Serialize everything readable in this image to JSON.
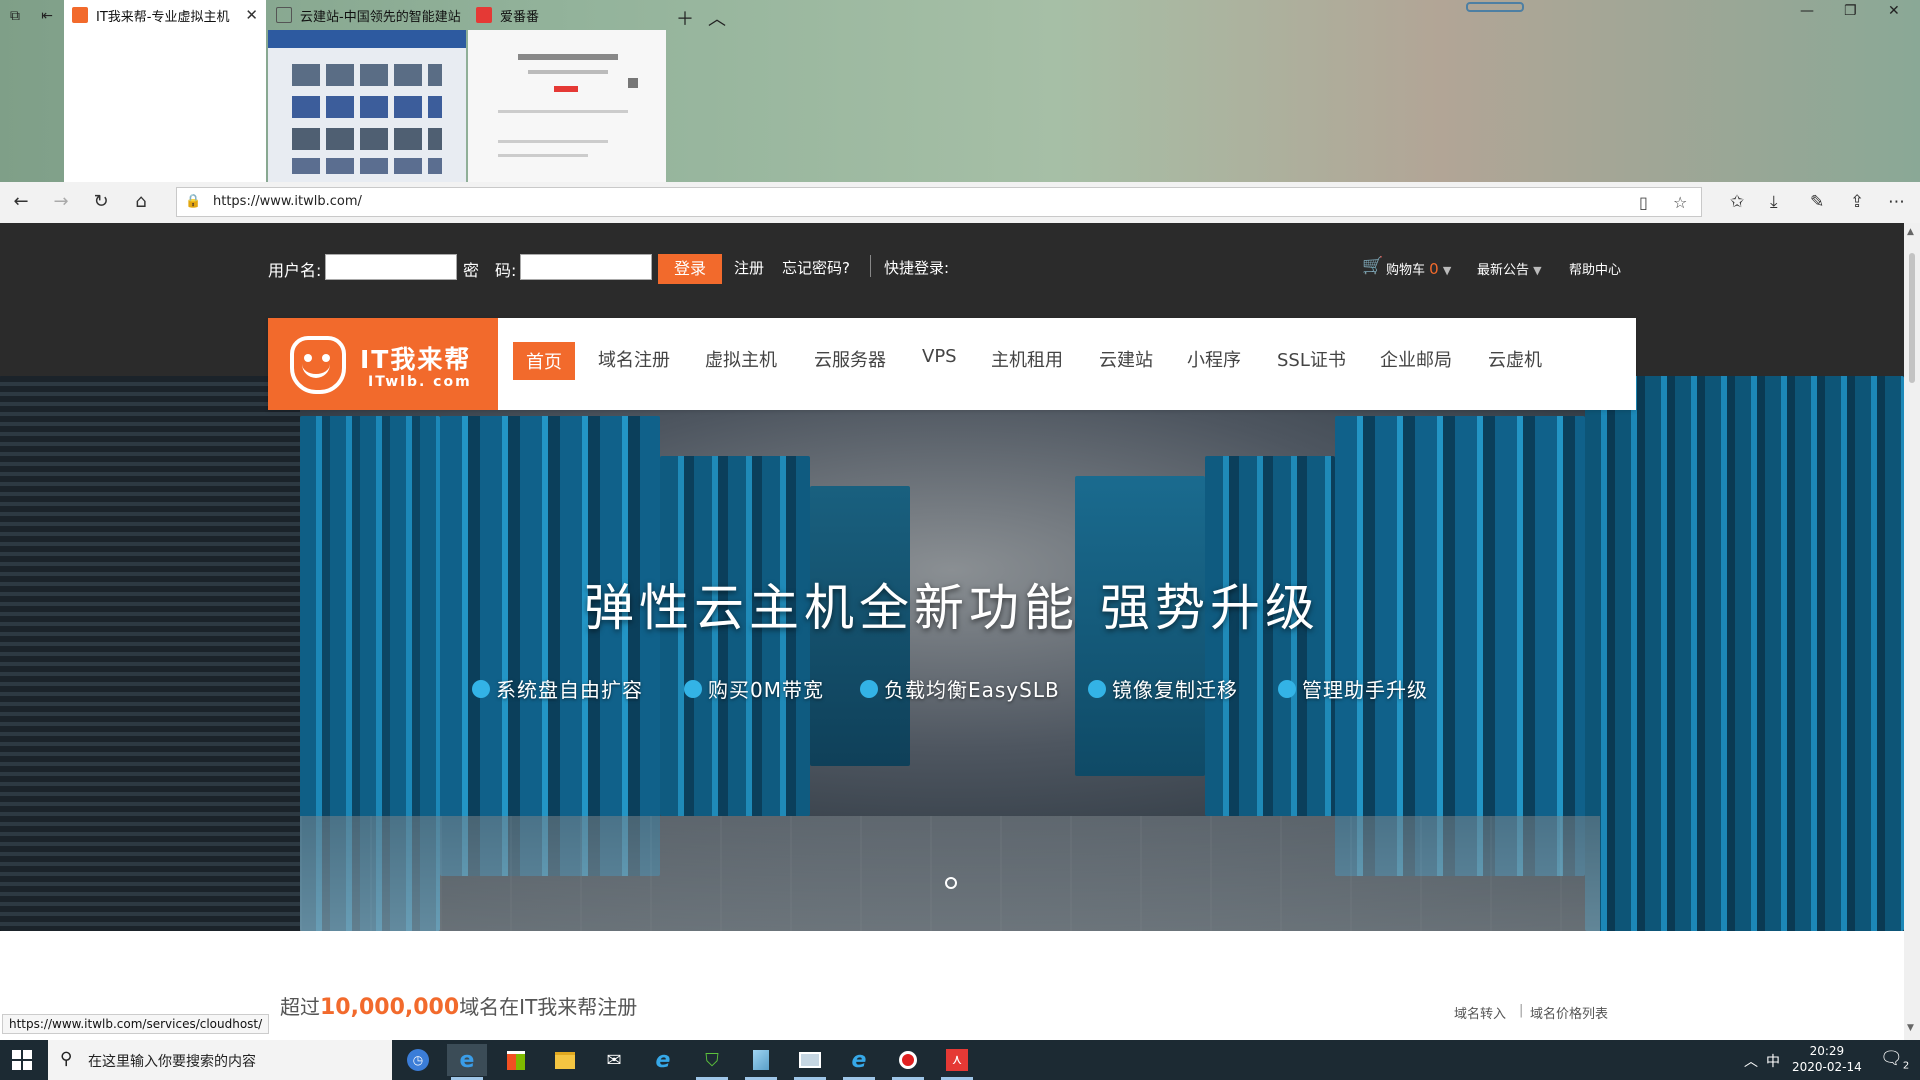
{
  "browser": {
    "tabs": [
      {
        "title": "IT我来帮-专业虚拟主机",
        "active": true,
        "favicon_color": "#f26a2c"
      },
      {
        "title": "云建站-中国领先的智能建站",
        "active": false,
        "favicon_color": "#777777"
      },
      {
        "title": "爱番番",
        "active": false,
        "favicon_color": "#e53935"
      }
    ],
    "url": "https://www.itwlb.com/",
    "status_url": "https://www.itwlb.com/services/cloudhost/"
  },
  "login": {
    "username_label": "用户名:",
    "password_label": "密　码:",
    "username_value": "",
    "password_value": "",
    "login_button": "登录",
    "register": "注册",
    "forgot": "忘记密码?",
    "quick_login": "快捷登录:"
  },
  "top_right": {
    "cart_label": "购物车",
    "cart_count": "0",
    "announcements": "最新公告",
    "help": "帮助中心"
  },
  "logo": {
    "cn": "IT我来帮",
    "en": "ITwlb. com"
  },
  "nav": [
    {
      "label": "首页",
      "active": true
    },
    {
      "label": "域名注册",
      "active": false
    },
    {
      "label": "虚拟主机",
      "active": false
    },
    {
      "label": "云服务器",
      "active": false
    },
    {
      "label": "VPS",
      "active": false
    },
    {
      "label": "主机租用",
      "active": false
    },
    {
      "label": "云建站",
      "active": false
    },
    {
      "label": "小程序",
      "active": false
    },
    {
      "label": "SSL证书",
      "active": false
    },
    {
      "label": "企业邮局",
      "active": false
    },
    {
      "label": "云虚机",
      "active": false
    }
  ],
  "banner": {
    "title": "弹性云主机全新功能  强势升级",
    "features": [
      "系统盘自由扩容",
      "购买0M带宽",
      "负载均衡EasySLB",
      "镜像复制迁移",
      "管理助手升级"
    ]
  },
  "stats": {
    "prefix": "超过",
    "number": "10,000,000",
    "suffix": "域名在IT我来帮注册"
  },
  "domain_links": {
    "transfer": "域名转入",
    "sep": "|",
    "price_list": "域名价格列表"
  },
  "taskbar": {
    "search_placeholder": "在这里输入你要搜索的内容",
    "ime": "中",
    "time": "20:29",
    "date": "2020-02-14",
    "notification_count": "2"
  },
  "colors": {
    "accent": "#f26a2c",
    "feature_dot": "#33b3e6",
    "topbar": "#2b2b2b"
  }
}
